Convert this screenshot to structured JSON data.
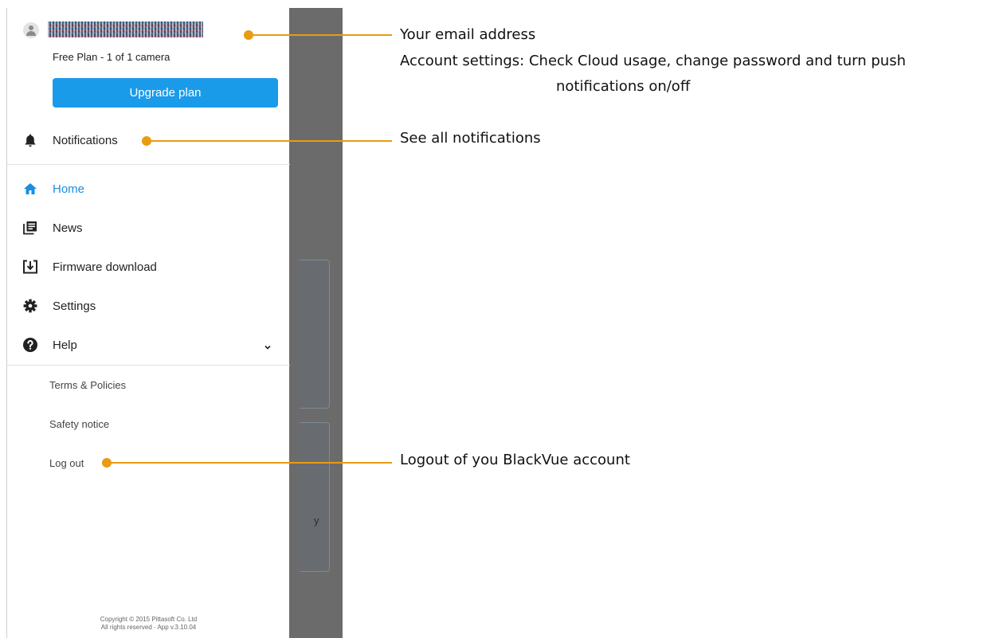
{
  "account": {
    "plan_label": "Free Plan - 1 of 1 camera",
    "upgrade_label": "Upgrade plan"
  },
  "menu": {
    "notifications": "Notifications",
    "home": "Home",
    "news": "News",
    "firmware": "Firmware download",
    "settings": "Settings",
    "help": "Help"
  },
  "help_sub": {
    "terms": "Terms & Policies",
    "safety": "Safety notice",
    "logout": "Log out"
  },
  "background": {
    "partial_text": "y"
  },
  "footer": {
    "copyright_line1": "Copyright © 2015 Pittasoft Co. Ltd",
    "copyright_line2": "All rights reserved · App v.3.10.04"
  },
  "annotations": {
    "email_title": "Your email address",
    "email_detail_1": "Account settings: Check Cloud usage, change password and turn push",
    "email_detail_2": "notifications on/off",
    "notifications": "See all notifications",
    "logout": "Logout of you BlackVue account"
  },
  "colors": {
    "accent": "#1a9bea",
    "annotation": "#e79c12",
    "backdrop": "#6b6b6b"
  }
}
